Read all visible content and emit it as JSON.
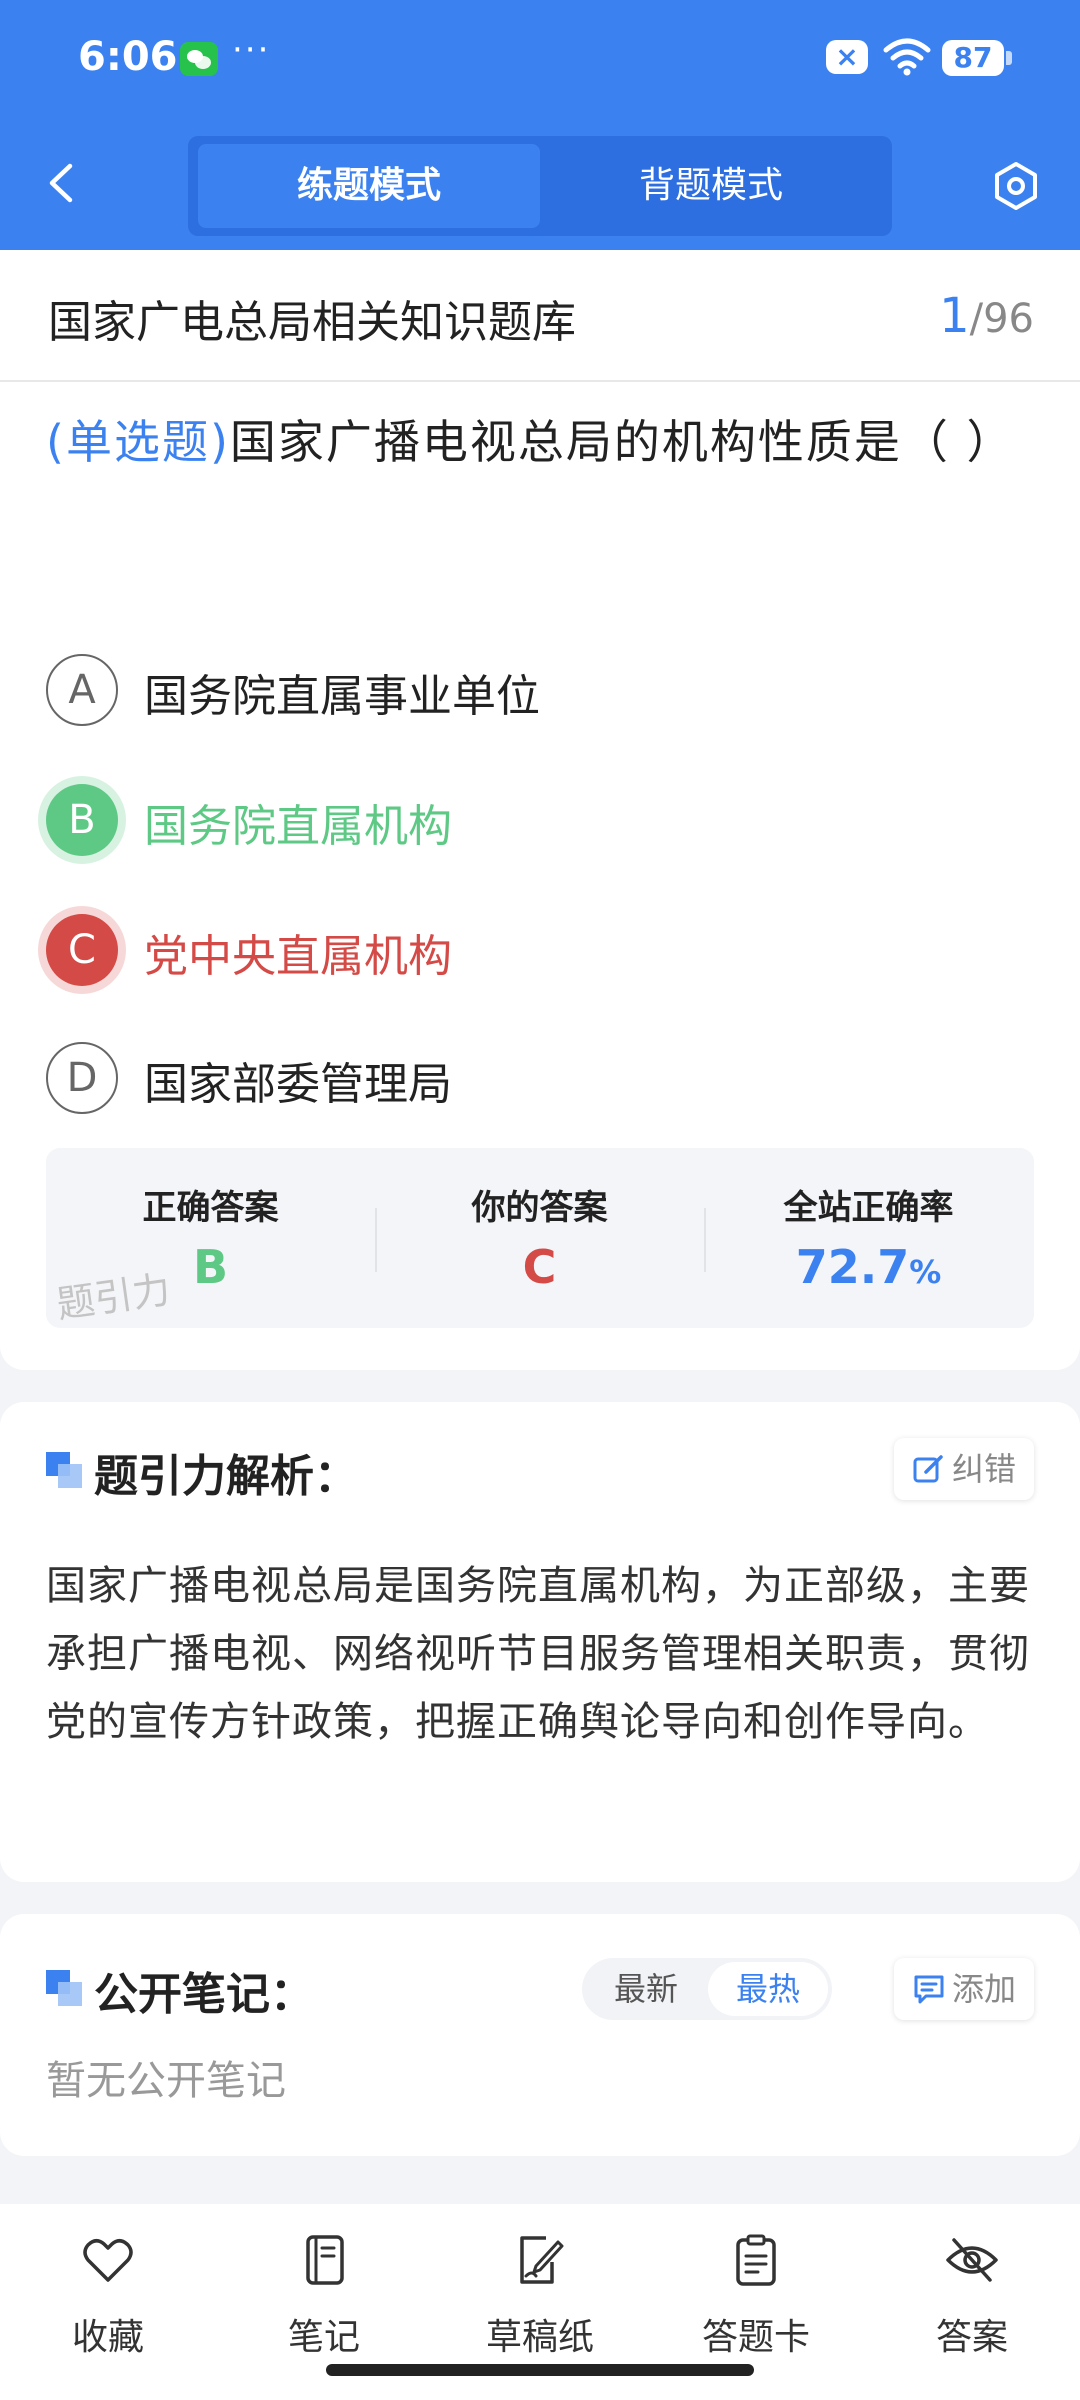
{
  "status_bar": {
    "time": "6:06",
    "more": "···",
    "close_badge": "×",
    "battery": "87"
  },
  "header": {
    "tabs": [
      {
        "label": "练题模式",
        "active": true
      },
      {
        "label": "背题模式",
        "active": false
      }
    ]
  },
  "question_card": {
    "bank_title": "国家广电总局相关知识题库",
    "progress": {
      "current": "1",
      "sep_total": "/96"
    },
    "question_type": "(单选题)",
    "question_text": "国家广播电视总局的机构性质是（ ）",
    "options": [
      {
        "letter": "A",
        "text": "国务院直属事业单位",
        "state": "normal"
      },
      {
        "letter": "B",
        "text": "国务院直属机构",
        "state": "correct"
      },
      {
        "letter": "C",
        "text": "党中央直属机构",
        "state": "wrong"
      },
      {
        "letter": "D",
        "text": "国家部委管理局",
        "state": "normal"
      }
    ],
    "stats": {
      "correct_label": "正确答案",
      "correct_value": "B",
      "yours_label": "你的答案",
      "yours_value": "C",
      "rate_label": "全站正确率",
      "rate_value": "72.7",
      "rate_unit": "%"
    },
    "watermark": "题引力"
  },
  "analysis": {
    "title": "题引力解析：",
    "report_label": "纠错",
    "text": "国家广播电视总局是国务院直属机构，为正部级，主要承担广播电视、网络视听节目服务管理相关职责，贯彻党的宣传方针政策，把握正确舆论导向和创作导向。"
  },
  "notes": {
    "title": "公开笔记：",
    "sort_newest": "最新",
    "sort_hottest": "最热",
    "add_label": "添加",
    "empty_text": "暂无公开笔记"
  },
  "bottom_nav": {
    "items": [
      {
        "label": "收藏",
        "icon": "heart-icon"
      },
      {
        "label": "笔记",
        "icon": "notebook-icon"
      },
      {
        "label": "草稿纸",
        "icon": "draft-pen-icon"
      },
      {
        "label": "答题卡",
        "icon": "answer-sheet-icon"
      },
      {
        "label": "答案",
        "icon": "eye-off-icon"
      }
    ]
  },
  "colors": {
    "brand_blue": "#3b82f0",
    "correct_green": "#5ec985",
    "wrong_red": "#d44a46"
  }
}
